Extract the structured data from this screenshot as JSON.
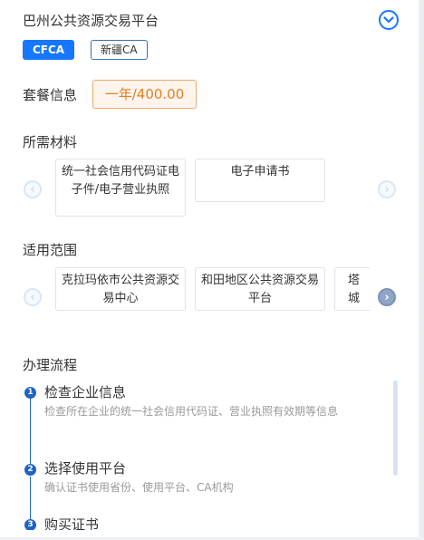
{
  "header": {
    "title": "巴州公共资源交易平台",
    "tags": [
      "CFCA",
      "新疆CA"
    ]
  },
  "package": {
    "label": "套餐信息",
    "value": "一年/400.00"
  },
  "materials": {
    "label": "所需材料",
    "items": [
      "统一社会信用代码证电子件/电子营业执照",
      "电子申请书"
    ]
  },
  "scope": {
    "label": "适用范围",
    "items": [
      "克拉玛依市公共资源交易中心",
      "和田地区公共资源交易平台",
      "塔城"
    ]
  },
  "process": {
    "label": "办理流程",
    "steps": [
      {
        "num": "1",
        "title": "检查企业信息",
        "desc": "检查所在企业的统一社会信用代码证、营业执照有效期等信息"
      },
      {
        "num": "2",
        "title": "选择使用平台",
        "desc": "确认证书使用省份、使用平台、CA机构"
      },
      {
        "num": "3",
        "title": "购买证书",
        "desc": ""
      }
    ]
  },
  "colors": {
    "primary": "#1677ff",
    "step": "#1f63c3",
    "price_text": "#e67e22",
    "price_border": "#f0a66b"
  }
}
